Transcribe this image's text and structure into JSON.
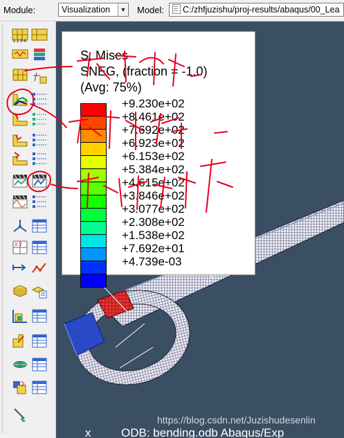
{
  "topbar": {
    "module_label": "Module:",
    "module_value": "Visualization",
    "model_label": "Model:",
    "model_value": "C:/zhfjuzishu/proj-results/abaqus/00_Lea"
  },
  "toolbox": {
    "tools": [
      {
        "name": "plot-undeformed-icon"
      },
      {
        "name": "plot-contours-icon"
      },
      {
        "name": "plot-deformed-icon"
      },
      {
        "name": "plot-symbols-icon"
      },
      {
        "name": "contour-options-icon"
      },
      {
        "name": "contour-plot-icon"
      },
      {
        "name": "plot-material-orientations-icon"
      },
      {
        "name": "allow-multiple-plot-states-icon"
      },
      {
        "name": "animate-scale-factor-icon"
      },
      {
        "name": "animate-time-history-icon"
      },
      {
        "name": "animation-options-icon"
      },
      {
        "name": "xy-data-icon"
      },
      {
        "name": "path-icon"
      },
      {
        "name": "report-icon"
      },
      {
        "name": "view-cut-icon"
      },
      {
        "name": "display-group-icon"
      },
      {
        "name": "probe-values-icon"
      },
      {
        "name": "edit-annotation-icon"
      }
    ]
  },
  "legend": {
    "title_1": "S, Mises",
    "title_2": "SNEG, (fraction = -1.0)",
    "title_3": "(Avg: 75%)",
    "values": [
      "+9.230e+02",
      "+8.461e+02",
      "+7.692e+02",
      "+6.923e+02",
      "+6.153e+02",
      "+5.384e+02",
      "+4.615e+02",
      "+3.846e+02",
      "+3.077e+02",
      "+2.308e+02",
      "+1.538e+02",
      "+7.692e+01",
      "+4.739e-03"
    ],
    "colors": [
      "#ff0000",
      "#ff4600",
      "#ff8c00",
      "#ffd200",
      "#e6ff00",
      "#a0ff00",
      "#5aff00",
      "#14ff00",
      "#00ff3c",
      "#00ff96",
      "#00e6e6",
      "#0096ff",
      "#0032ff",
      "#0000ff"
    ]
  },
  "status": {
    "text": "ODB: bending.odb    Abaqus/Exp"
  },
  "watermark": "https://blog.csdn.net/Juzishudesenlin",
  "annotations": {
    "ink_color": "#e8001c"
  }
}
